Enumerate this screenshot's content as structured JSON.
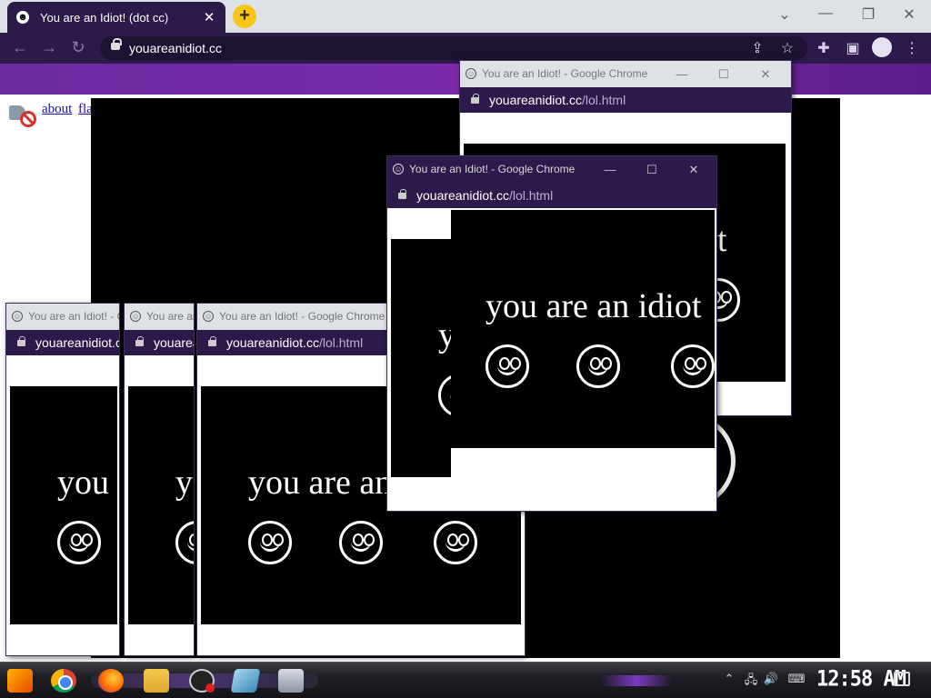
{
  "browser": {
    "tab_title": "You are an Idiot! (dot cc)",
    "new_tab_label": "+",
    "url": "youareanidiot.cc",
    "icons": [
      "back-icon",
      "forward-icon",
      "reload-icon",
      "lock-icon",
      "share-icon",
      "star-icon",
      "extensions-icon",
      "sidepanel-icon",
      "profile-icon",
      "menu-icon"
    ]
  },
  "page": {
    "links": [
      "about",
      "flash"
    ]
  },
  "popups": {
    "title": "You are an Idiot! - Google Chrome",
    "url_host": "youareanidiot.cc",
    "url_path": "/lol.html",
    "text": "you are an idiot"
  },
  "taskbar": {
    "clock": "12:58 AM",
    "apps": [
      "start",
      "chrome",
      "firefox",
      "file-explorer",
      "screen-recorder",
      "app",
      "app"
    ]
  },
  "colors": {
    "chrome_frame": "#2b1a4a",
    "bookmark_bar": "#6b2aa0",
    "new_tab": "#f5c518",
    "flash_bg": "#000000"
  }
}
